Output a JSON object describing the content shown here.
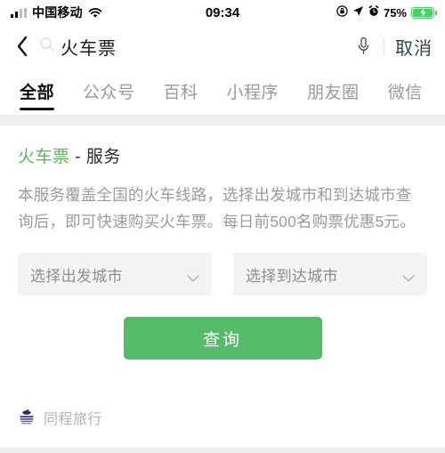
{
  "statusbar": {
    "carrier": "中国移动",
    "signal_icon": "signal-bars-icon",
    "wifi_icon": "wifi-icon",
    "time": "09:34",
    "rotation_lock_icon": "rotation-lock-icon",
    "location_icon": "location-arrow-icon",
    "alarm_icon": "alarm-clock-icon",
    "battery_percent": "75%",
    "battery_icon": "battery-charging-icon",
    "battery_color": "#4cd164"
  },
  "searchbar": {
    "back_icon": "back-chevron-icon",
    "search_icon": "search-icon",
    "query": "火车票",
    "mic_icon": "microphone-icon",
    "cancel_label": "取消"
  },
  "tabs": {
    "active_index": 0,
    "items": [
      {
        "label": "全部"
      },
      {
        "label": "公众号"
      },
      {
        "label": "百科"
      },
      {
        "label": "小程序"
      },
      {
        "label": "朋友圈"
      },
      {
        "label": "微信"
      }
    ]
  },
  "card": {
    "title_highlight": "火车票",
    "title_rest": " - 服务",
    "title_highlight_color": "#5cb85c",
    "description": "本服务覆盖全国的火车线路，选择出发城市和到达城市查询后，即可快速购买火车票。每日前500名购票优惠5元。",
    "selects": [
      {
        "placeholder": "选择出发城市",
        "value": "",
        "chevron_icon": "chevron-down-icon"
      },
      {
        "placeholder": "选择到达城市",
        "value": "",
        "chevron_icon": "chevron-down-icon"
      }
    ],
    "query_button": {
      "label": "查询",
      "color": "#55bb6a"
    }
  },
  "footer": {
    "logo_icon": "tongcheng-logo-icon",
    "provider": "同程旅行"
  }
}
